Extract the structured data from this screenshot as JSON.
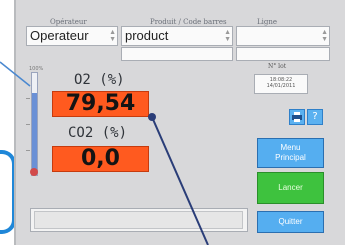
{
  "header": {
    "operator_label": "Opérateur",
    "product_label": "Produit / Code barres",
    "line_label": "Ligne"
  },
  "fields": {
    "operator_value": "Operateur",
    "product_value": "product",
    "line_value": ""
  },
  "measurements": {
    "scale_label": "100%",
    "o2_label": "O2 (%)",
    "o2_value": "79,54",
    "co2_label": "CO2 (%)",
    "co2_value": "0,0",
    "o2_gauge_level_percent": 80
  },
  "sidebar": {
    "lot_label": "N° lot",
    "datetime": "18:08:22\n14/01/2011",
    "help_label": "?",
    "menu_button": "Menu\nPrincipal",
    "start_button": "Lancer",
    "quit_button": "Quitter"
  },
  "colors": {
    "value_box": "#ff5a1f",
    "menu_button": "#55aef0",
    "start_button": "#3ec23e",
    "quit_button": "#55aef0",
    "callout": "#1f87d8",
    "pointer_line": "#2a3d78"
  }
}
